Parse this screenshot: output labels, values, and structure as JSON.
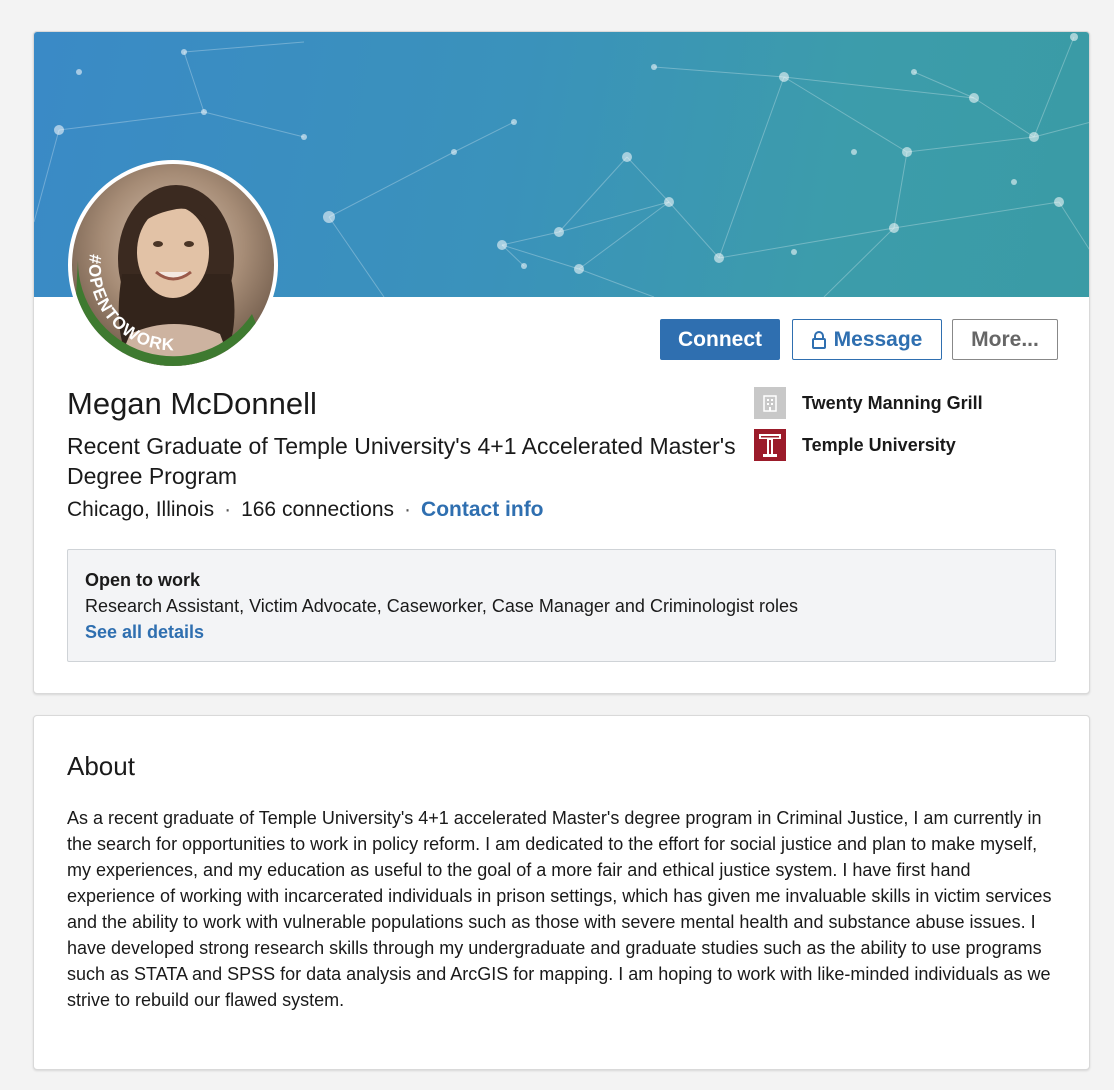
{
  "profile": {
    "name": "Megan McDonnell",
    "headline": "Recent Graduate of Temple University's 4+1 Accelerated Master's Degree Program",
    "location": "Chicago, Illinois",
    "connections": "166 connections",
    "contact_info": "Contact info",
    "avatar_badge": "#OPENTOWORK"
  },
  "actions": {
    "connect": "Connect",
    "message": "Message",
    "more": "More..."
  },
  "organizations": [
    {
      "name": "Twenty Manning Grill",
      "icon": "building-icon"
    },
    {
      "name": "Temple University",
      "icon": "temple-t-logo"
    }
  ],
  "open_to_work": {
    "title": "Open to work",
    "roles": "Research Assistant, Victim Advocate, Caseworker, Case Manager and Criminologist roles",
    "link": "See all details"
  },
  "about": {
    "title": "About",
    "body": "As a recent graduate of Temple University's 4+1 accelerated Master's degree program in Criminal Justice, I am currently in the search for opportunities to work in policy reform. I am dedicated to the effort for social justice and plan to make myself, my experiences, and my education as useful to the goal of a more fair and ethical justice system. I have first hand experience of working with incarcerated individuals in prison settings, which has given me invaluable skills in victim services and the ability to work with vulnerable populations such as those with severe mental health and substance abuse issues. I have developed strong research skills through my undergraduate and graduate studies such as the ability to use programs such as STATA and SPSS for data analysis and ArcGIS for mapping. I am hoping to work with like-minded individuals as we strive to rebuild our flawed system."
  },
  "colors": {
    "accent": "#2f6fb0",
    "open_to_work_green": "#3e7a30",
    "temple_red": "#9b1b2a"
  }
}
